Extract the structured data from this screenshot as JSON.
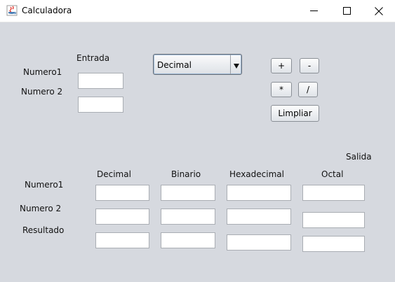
{
  "window": {
    "title": "Calculadora"
  },
  "input_section": {
    "heading": "Entrada",
    "numero1_label": "Numero1",
    "numero2_label": "Numero 2",
    "numero1_value": "",
    "numero2_value": ""
  },
  "base_select": {
    "selected": "Decimal"
  },
  "operations": {
    "add": "+",
    "subtract": "-",
    "multiply": "*",
    "divide": "/",
    "clear": "Limpliar"
  },
  "output_section": {
    "heading": "Salida",
    "columns": [
      "Decimal",
      "Binario",
      "Hexadecimal",
      "Octal"
    ],
    "rows": [
      "Numero1",
      "Numero 2",
      "Resultado"
    ]
  },
  "icons": {
    "app": "java-cup-icon",
    "minimize": "minimize-icon",
    "maximize": "maximize-icon",
    "close": "close-icon",
    "dropdown": "triangle-down-icon"
  }
}
